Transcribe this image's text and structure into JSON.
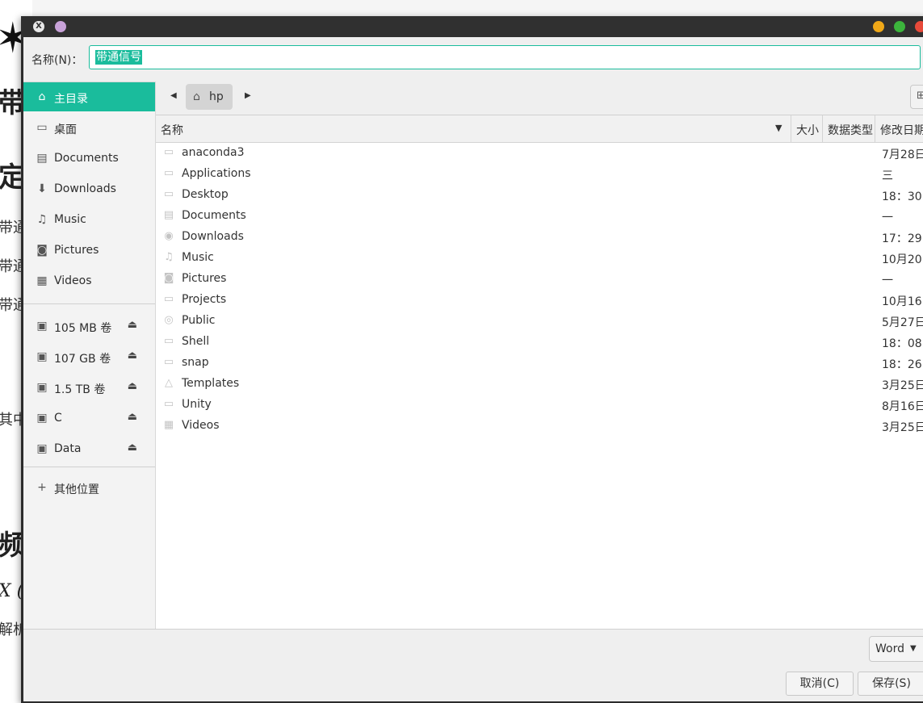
{
  "background_doc": {
    "star": "✶",
    "heading1": "带",
    "heading2": "定",
    "lines": [
      "带通",
      "带通",
      "带通"
    ],
    "line_other": "其中",
    "heading3": "频",
    "formula": "X (",
    "line_last": "解析"
  },
  "dialog": {
    "name_label": "名称(N)：",
    "name_value": "带通信号",
    "sidebar": {
      "places": [
        {
          "label": "主目录",
          "icon": "home-icon",
          "glyph": "⌂",
          "active": true
        },
        {
          "label": "桌面",
          "icon": "desktop-icon",
          "glyph": "▭",
          "active": false
        },
        {
          "label": "Documents",
          "icon": "documents-icon",
          "glyph": "▤",
          "active": false
        },
        {
          "label": "Downloads",
          "icon": "downloads-icon",
          "glyph": "⬇",
          "active": false
        },
        {
          "label": "Music",
          "icon": "music-icon",
          "glyph": "♫",
          "active": false
        },
        {
          "label": "Pictures",
          "icon": "camera-icon",
          "glyph": "◙",
          "active": false
        },
        {
          "label": "Videos",
          "icon": "film-icon",
          "glyph": "▦",
          "active": false
        }
      ],
      "volumes": [
        {
          "label": "105 MB 卷",
          "icon": "drive-icon",
          "glyph": "▣"
        },
        {
          "label": "107 GB 卷",
          "icon": "drive-icon",
          "glyph": "▣"
        },
        {
          "label": "1.5 TB 卷",
          "icon": "drive-icon",
          "glyph": "▣"
        },
        {
          "label": "C",
          "icon": "drive-icon",
          "glyph": "▣"
        },
        {
          "label": "Data",
          "icon": "drive-icon",
          "glyph": "▣"
        }
      ],
      "eject_glyph": "⏏",
      "other_locations": {
        "label": "其他位置",
        "glyph": "+"
      }
    },
    "path": {
      "back_glyph": "◀",
      "forward_glyph": "▶",
      "home_glyph": "⌂",
      "current": "hp",
      "new_folder_glyph": "⊞"
    },
    "columns": {
      "name": "名称",
      "size": "大小",
      "type": "数据类型",
      "modified": "修改日期",
      "sort_glyph": "▼"
    },
    "files": [
      {
        "name": "anaconda3",
        "modified": "7月28日",
        "icon": "folder-icon",
        "glyph": "▭"
      },
      {
        "name": "Applications",
        "modified": "三",
        "icon": "folder-icon",
        "glyph": "▭"
      },
      {
        "name": "Desktop",
        "modified": "18：30",
        "icon": "desktop-icon",
        "glyph": "▭"
      },
      {
        "name": "Documents",
        "modified": "一",
        "icon": "documents-icon",
        "glyph": "▤"
      },
      {
        "name": "Downloads",
        "modified": "17：29",
        "icon": "downloads-icon",
        "glyph": "◉"
      },
      {
        "name": "Music",
        "modified": "10月20日",
        "icon": "music-icon",
        "glyph": "♫"
      },
      {
        "name": "Pictures",
        "modified": "一",
        "icon": "camera-icon",
        "glyph": "◙"
      },
      {
        "name": "Projects",
        "modified": "10月16日",
        "icon": "folder-icon",
        "glyph": "▭"
      },
      {
        "name": "Public",
        "modified": "5月27日",
        "icon": "share-icon",
        "glyph": "◎"
      },
      {
        "name": "Shell",
        "modified": "18：08",
        "icon": "folder-icon",
        "glyph": "▭"
      },
      {
        "name": "snap",
        "modified": "18：26",
        "icon": "folder-icon",
        "glyph": "▭"
      },
      {
        "name": "Templates",
        "modified": "3月25日",
        "icon": "templates-icon",
        "glyph": "△"
      },
      {
        "name": "Unity",
        "modified": "8月16日",
        "icon": "folder-icon",
        "glyph": "▭"
      },
      {
        "name": "Videos",
        "modified": "3月25日",
        "icon": "film-icon",
        "glyph": "▦"
      }
    ],
    "filter": {
      "label": "Word",
      "arrow": "▼"
    },
    "buttons": {
      "cancel": "取消(C)",
      "save": "保存(S)"
    },
    "titlebar": {
      "x_glyph": "X"
    }
  },
  "colors": {
    "accent": "#1abc9c",
    "titlebar": "#303030",
    "close": "#e84a3a",
    "maximize": "#3cb43c",
    "minimize": "#f0a818"
  }
}
